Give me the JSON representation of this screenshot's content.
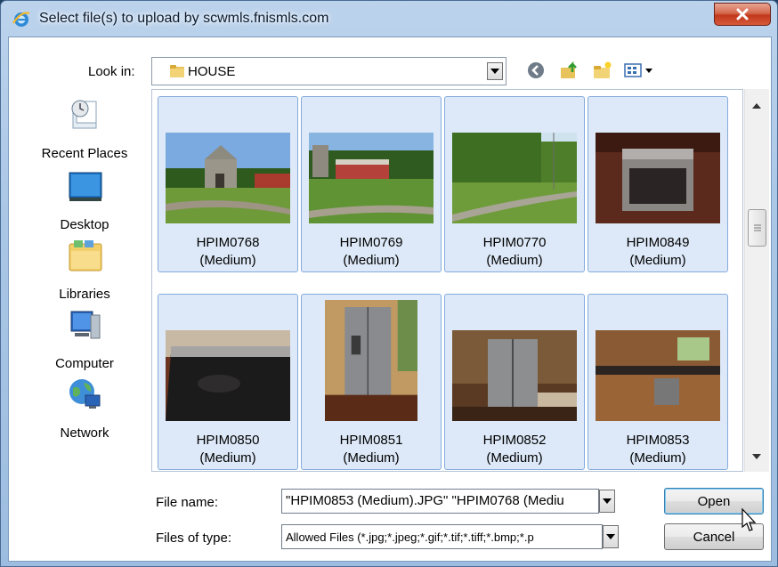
{
  "window": {
    "title": "Select file(s) to upload by scwmls.fnismls.com"
  },
  "lookin": {
    "label": "Look in:",
    "value": "HOUSE"
  },
  "places": [
    {
      "label": "Recent Places",
      "icon": "recent-places-icon"
    },
    {
      "label": "Desktop",
      "icon": "desktop-icon"
    },
    {
      "label": "Libraries",
      "icon": "libraries-icon"
    },
    {
      "label": "Computer",
      "icon": "computer-icon"
    },
    {
      "label": "Network",
      "icon": "network-icon"
    }
  ],
  "files": [
    {
      "name": "HPIM0768\n(Medium)",
      "scene": "barn"
    },
    {
      "name": "HPIM0769\n(Medium)",
      "scene": "shed"
    },
    {
      "name": "HPIM0770\n(Medium)",
      "scene": "field"
    },
    {
      "name": "HPIM0849\n(Medium)",
      "scene": "stove"
    },
    {
      "name": "HPIM0850\n(Medium)",
      "scene": "cooktop"
    },
    {
      "name": "HPIM0851\n(Medium)",
      "scene": "fridge"
    },
    {
      "name": "HPIM0852\n(Medium)",
      "scene": "fridge-room"
    },
    {
      "name": "HPIM0853\n(Medium)",
      "scene": "kitchen"
    }
  ],
  "filename": {
    "label": "File name:",
    "value": "\"HPIM0853 (Medium).JPG\" \"HPIM0768 (Mediu"
  },
  "filetype": {
    "label": "Files of type:",
    "value": "Allowed Files (*.jpg;*.jpeg;*.gif;*.tif;*.tiff;*.bmp;*.p"
  },
  "buttons": {
    "open": "Open",
    "cancel": "Cancel"
  },
  "colors": {
    "title_bar": "#a9c6e6",
    "selection": "#dde9f8",
    "close": "#c2391c"
  }
}
